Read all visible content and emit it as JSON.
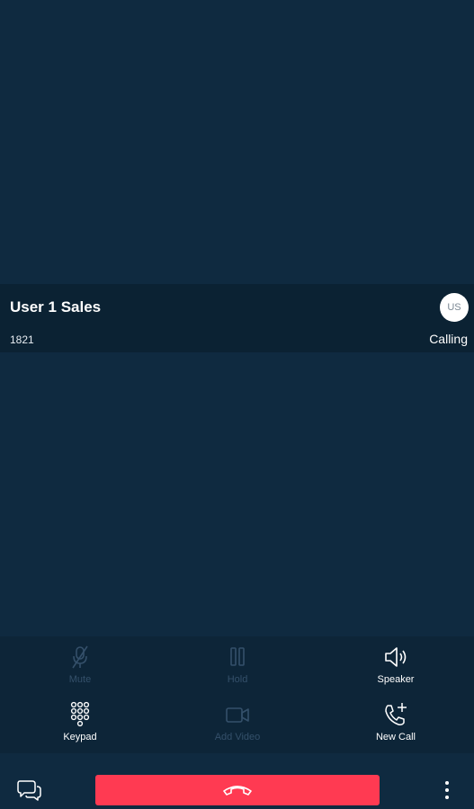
{
  "caller": {
    "name": "User 1 Sales",
    "number": "1821",
    "initials": "US",
    "status": "Calling"
  },
  "controls": {
    "mute": {
      "label": "Mute",
      "icon": "mic-off-icon",
      "enabled": false
    },
    "hold": {
      "label": "Hold",
      "icon": "pause-icon",
      "enabled": false
    },
    "speaker": {
      "label": "Speaker",
      "icon": "speaker-icon",
      "enabled": true
    },
    "keypad": {
      "label": "Keypad",
      "icon": "keypad-icon",
      "enabled": true
    },
    "add_video": {
      "label": "Add Video",
      "icon": "video-camera-icon",
      "enabled": false
    },
    "new_call": {
      "label": "New Call",
      "icon": "phone-plus-icon",
      "enabled": true
    }
  },
  "bottom": {
    "chat_icon": "chat-bubbles-icon",
    "end_call_icon": "hang-up-icon",
    "more_icon": "more-vertical-icon"
  },
  "colors": {
    "background": "#0f2a40",
    "caller_card": "#0b2233",
    "end_call": "#ff3a52",
    "disabled": "#34506a"
  }
}
